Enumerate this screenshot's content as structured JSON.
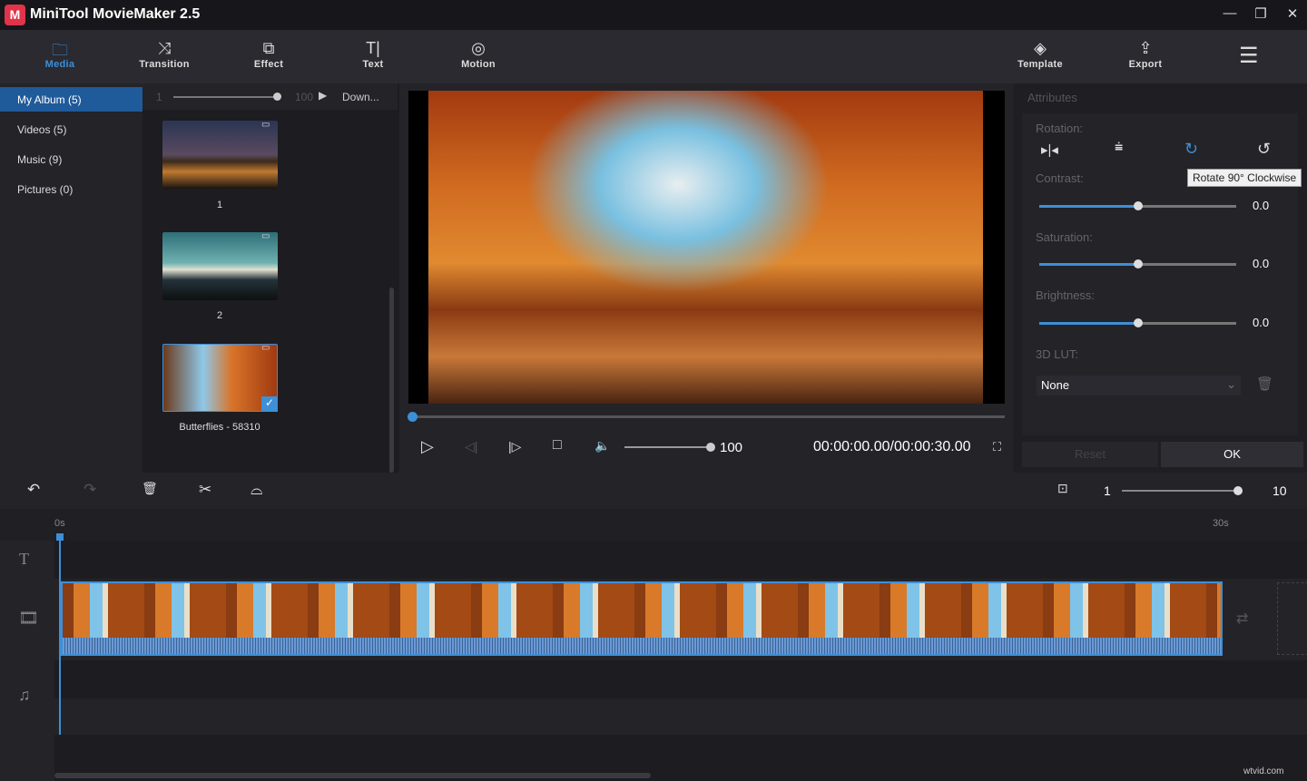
{
  "app": {
    "title": "MiniTool MovieMaker 2.5",
    "logo_text": "M"
  },
  "window": {
    "minimize": "—",
    "restore": "❐",
    "close": "✕"
  },
  "toolbar": {
    "items": [
      {
        "label": "Media",
        "icon": "folder-icon",
        "glyph": "🗀"
      },
      {
        "label": "Transition",
        "icon": "transition-icon",
        "glyph": "⤨"
      },
      {
        "label": "Effect",
        "icon": "effect-icon",
        "glyph": "⧉"
      },
      {
        "label": "Text",
        "icon": "text-icon",
        "glyph": "T|"
      },
      {
        "label": "Motion",
        "icon": "motion-icon",
        "glyph": "◎"
      }
    ],
    "right": [
      {
        "label": "Template",
        "icon": "template-icon",
        "glyph": "◈"
      },
      {
        "label": "Export",
        "icon": "export-icon",
        "glyph": "⇪"
      }
    ],
    "menu_glyph": "☰"
  },
  "sidebar": {
    "items": [
      {
        "label": "My Album  (5)"
      },
      {
        "label": "Videos  (5)"
      },
      {
        "label": "Music  (9)"
      },
      {
        "label": "Pictures  (0)"
      }
    ]
  },
  "media": {
    "zoom_min": "1",
    "zoom_max": "100",
    "download": "Down...",
    "items": [
      {
        "label": "1"
      },
      {
        "label": "2"
      },
      {
        "label": "Butterflies - 58310",
        "selected": true
      }
    ]
  },
  "player": {
    "volume": "100",
    "time": "00:00:00.00/00:00:30.00",
    "progress": 0
  },
  "attributes": {
    "title": "Attributes",
    "rotation_label": "Rotation:",
    "tooltip": "Rotate 90° Clockwise",
    "contrast_label": "Contrast:",
    "contrast": "0.0",
    "saturation_label": "Saturation:",
    "saturation": "0.0",
    "brightness_label": "Brightness:",
    "brightness": "0.0",
    "lut_label": "3D LUT:",
    "lut_value": "None",
    "reset": "Reset",
    "ok": "OK",
    "accent": "#3d8fd8"
  },
  "timeline": {
    "zoom_min": "1",
    "zoom_max": "10",
    "ruler_start": "0s",
    "ruler_end": "30s"
  },
  "watermark": "wtvid.com"
}
